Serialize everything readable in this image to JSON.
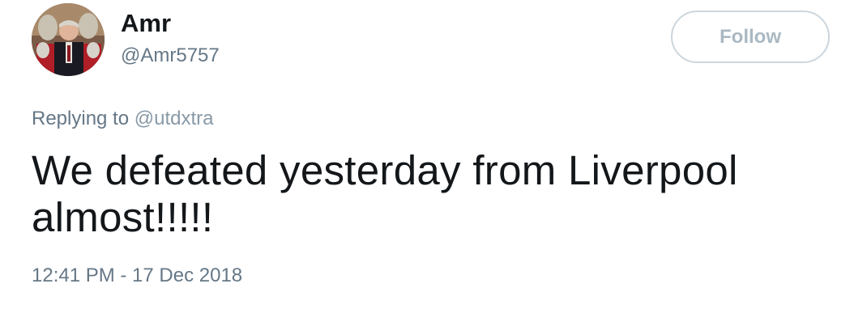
{
  "user": {
    "display_name": "Amr",
    "handle": "@Amr5757"
  },
  "follow_button": {
    "label": "Follow"
  },
  "reply_context": {
    "prefix": "Replying to",
    "mention": "@utdxtra"
  },
  "tweet": {
    "text": "We defeated yesterday from Liverpool almost!!!!!",
    "timestamp": "12:41 PM - 17 Dec 2018"
  },
  "colors": {
    "text_primary": "#14171a",
    "text_secondary": "#657786",
    "button_border": "#ccd6dd",
    "button_text": "#aab8c2"
  }
}
